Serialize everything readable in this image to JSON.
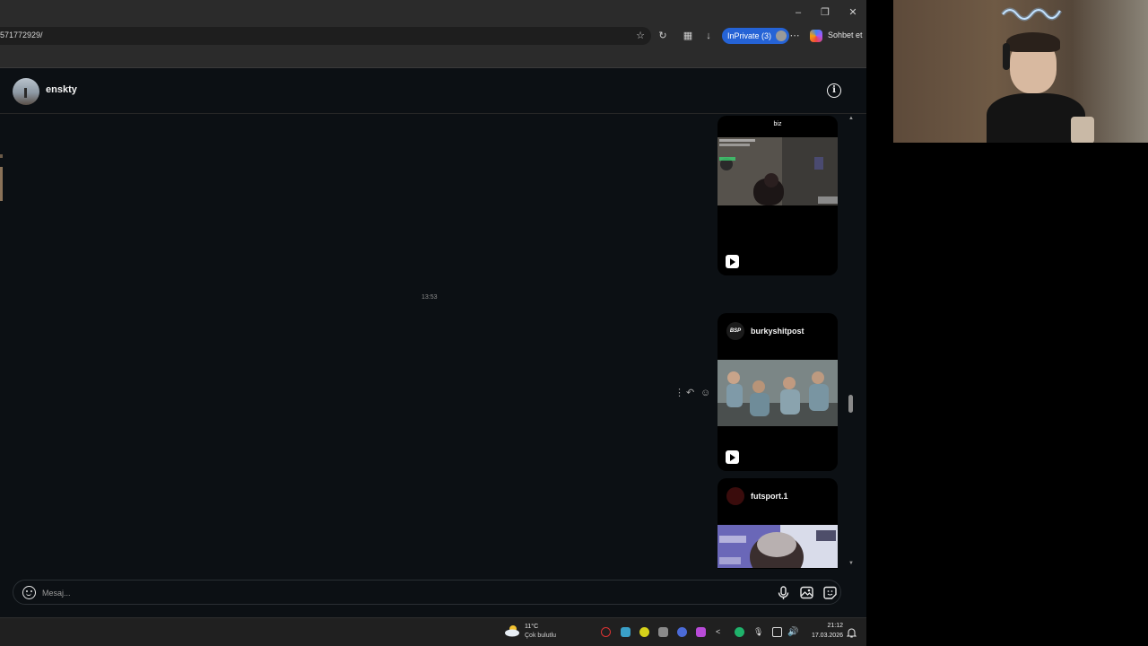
{
  "browser": {
    "url": "571772929/",
    "inprivate_label": "InPrivate (3)",
    "copilot_label": "Sohbet et"
  },
  "dm": {
    "username": "enskty",
    "timestamp": "13:53",
    "composer_placeholder": "Mesaj..."
  },
  "messages": [
    {
      "top_label": "biz",
      "kind": "reel"
    },
    {
      "source": "burkyshitpost",
      "source_avatar_text": "BSP",
      "kind": "reel"
    },
    {
      "source": "futsport.1",
      "kind": "reel"
    }
  ],
  "taskbar": {
    "weather_temp": "11°C",
    "weather_cond": "Çok bulutlu",
    "time": "21:12",
    "date": "17.03.2026"
  },
  "colors": {
    "page_bg": "#0c1014",
    "inprivate": "#2563d6",
    "text": "#f5f5f5"
  }
}
